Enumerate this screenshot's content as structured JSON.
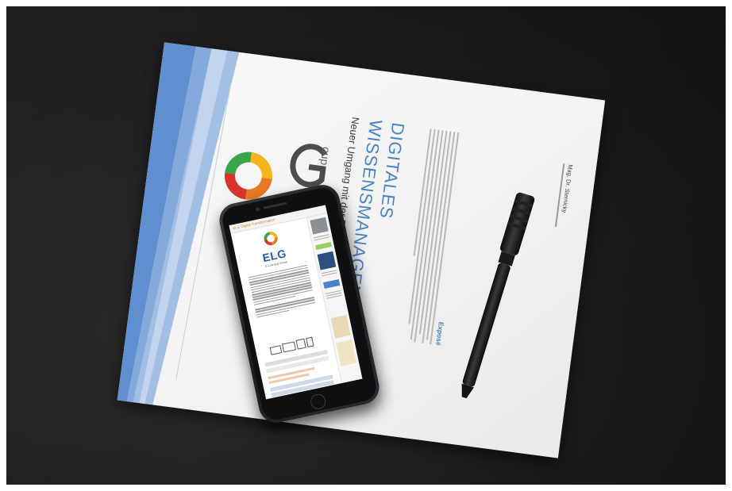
{
  "document": {
    "title_line1": "DIGITALES",
    "title_line2": "WISSENSMANAGEMENT",
    "subtitle": "Neuer Umgang mit der Ressource Wissen",
    "section_label": "Exposé",
    "author_name": "Mag. Dr. Sternicky",
    "brand_partial": "oup"
  },
  "phone": {
    "header_text": "ELG Digital Transformation",
    "logo_text": "ELG",
    "logo_subtext": "E-Learning Group"
  },
  "colors": {
    "desk": "#1c1c1e",
    "paper": "#f3f3f3",
    "accent_blue": "#4a83c8",
    "logo_green": "#3aa54a",
    "logo_yellow": "#f2b61c",
    "logo_orange": "#e87a22",
    "logo_red": "#d9342b",
    "logo_blue": "#2f79c5"
  },
  "icons": [
    "pen-icon",
    "elg-logo-icon"
  ]
}
